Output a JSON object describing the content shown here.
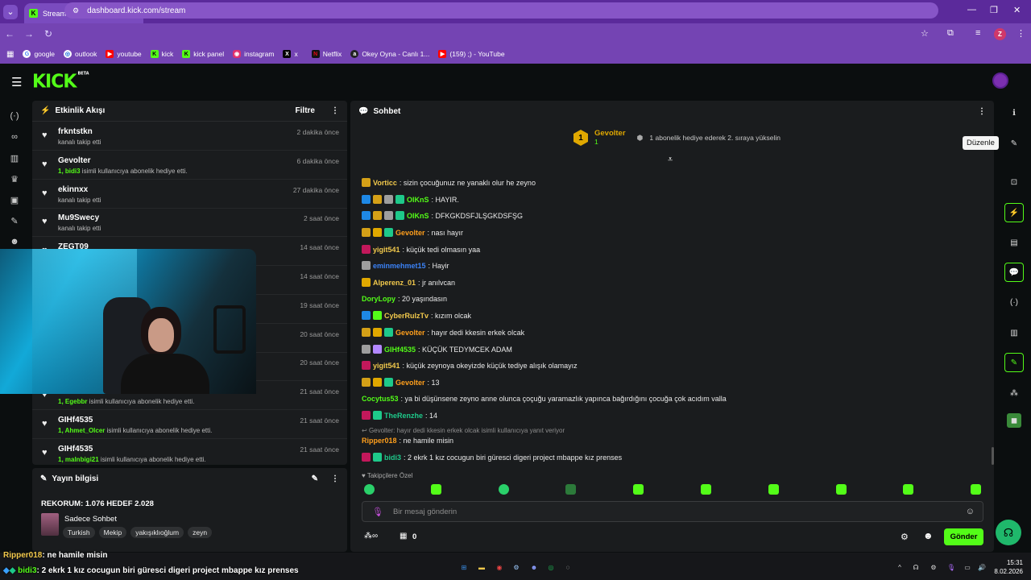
{
  "browser": {
    "tab_title": "Stream - Kick Dashboard",
    "url": "dashboard.kick.com/stream",
    "profile_initial": "Z",
    "bookmarks": [
      {
        "label": "google",
        "color": "#4285f4"
      },
      {
        "label": "outlook",
        "color": "#0a64d8"
      },
      {
        "label": "youtube",
        "color": "#ff0000"
      },
      {
        "label": "kick",
        "color": "#53fc18"
      },
      {
        "label": "kick panel",
        "color": "#53fc18"
      },
      {
        "label": "instagram",
        "color": "#e1306c"
      },
      {
        "label": "x",
        "color": "#000000"
      },
      {
        "label": "Netflix",
        "color": "#e50914"
      },
      {
        "label": "Okey Oyna - Canlı 1...",
        "color": "#222222"
      },
      {
        "label": "(159) ;) - YouTube",
        "color": "#ff0000"
      }
    ]
  },
  "kick": {
    "logo": "KICK",
    "logo_sup": "BETA"
  },
  "activity": {
    "title": "Etkinlik Akışı",
    "filter_label": "Filtre",
    "items": [
      {
        "name": "frkntstkn",
        "sub_count": "",
        "sub": "kanalı takip etti",
        "time": "2 dakika önce"
      },
      {
        "name": "Gevolter",
        "sub_count": "1, bidi3",
        "sub": "isimli kullanıcıya abonelik hediye etti.",
        "time": "6 dakika önce"
      },
      {
        "name": "ekinnxx",
        "sub_count": "",
        "sub": "kanalı takip etti",
        "time": "27 dakika önce"
      },
      {
        "name": "Mu9Swecy",
        "sub_count": "",
        "sub": "kanalı takip etti",
        "time": "2 saat önce"
      },
      {
        "name": "ZEGT09",
        "sub_count": "",
        "sub": "",
        "time": "14 saat önce"
      },
      {
        "name": "",
        "sub_count": "",
        "sub": "",
        "time": "14 saat önce"
      },
      {
        "name": "",
        "sub_count": "",
        "sub": "",
        "time": "19 saat önce"
      },
      {
        "name": "",
        "sub_count": "",
        "sub": "",
        "time": "20 saat önce"
      },
      {
        "name": "",
        "sub_count": "",
        "sub": "",
        "time": "20 saat önce"
      },
      {
        "name": "GIHf4535",
        "sub_count": "1, Egebbr",
        "sub": "isimli kullanıcıya abonelik hediye etti.",
        "time": "21 saat önce"
      },
      {
        "name": "GIHf4535",
        "sub_count": "1, Ahmet_Olcer",
        "sub": "isimli kullanıcıya abonelik hediye etti.",
        "time": "21 saat önce"
      },
      {
        "name": "GIHf4535",
        "sub_count": "1, malnbigi21",
        "sub": "isimli kullanıcıya abonelik hediye etti.",
        "time": "21 saat önce"
      }
    ]
  },
  "stream_info": {
    "title": "Yayın bilgisi",
    "stream_title": "REKORUM: 1.076 HEDEF 2.028",
    "category": "Sadece Sohbet",
    "tags": [
      "Turkish",
      "Mekip",
      "yakışıklıoğlum",
      "zeyn"
    ]
  },
  "chat": {
    "title": "Sohbet",
    "pinned_user": "Gevolter",
    "pinned_rank": "1",
    "pinned_count": "1",
    "pinned_text": "1 abonelik hediye ederek 2. sıraya yükselin",
    "messages": [
      {
        "user": "Vorticc",
        "color": "#f2c94c",
        "text": ": sizin çocuğunuz ne yanaklı olur he zeyno",
        "badges": [
          "#d4a017"
        ]
      },
      {
        "user": "OIKnS",
        "color": "#53fc18",
        "text": ": HAYIR.",
        "badges": [
          "#1e88e5",
          "#d4a017",
          "#9e9e9e",
          "#1ec98a"
        ]
      },
      {
        "user": "OIKnS",
        "color": "#53fc18",
        "text": ": DFKGKDSFJLŞGKDSFŞG",
        "badges": [
          "#1e88e5",
          "#d4a017",
          "#9e9e9e",
          "#1ec98a"
        ]
      },
      {
        "user": "Gevolter",
        "color": "#ff9f1c",
        "text": ": nası hayır",
        "badges": [
          "#d4a017",
          "#e0a800",
          "#1ec98a"
        ]
      },
      {
        "user": "yigit541",
        "color": "#f2c94c",
        "text": ": küçük tedi olmasın yaa",
        "badges": [
          "#c2185b"
        ]
      },
      {
        "user": "eminmehmet15",
        "color": "#3b82f6",
        "text": ": Hayir",
        "badges": [
          "#9e9e9e"
        ]
      },
      {
        "user": "Alperenz_01",
        "color": "#f2c94c",
        "text": ": jr anılvcan",
        "badges": [
          "#e0a800"
        ]
      },
      {
        "user": "DoryLopy",
        "color": "#53fc18",
        "text": ": 20 yaşındasın",
        "badges": []
      },
      {
        "user": "CyberRulzTv",
        "color": "#f2c94c",
        "text": ": kızım olcak",
        "badges": [
          "#1e88e5",
          "#53fc18"
        ]
      },
      {
        "user": "Gevolter",
        "color": "#ff9f1c",
        "text": ": hayır dedi kkesin erkek olcak",
        "badges": [
          "#d4a017",
          "#e0a800",
          "#1ec98a"
        ]
      },
      {
        "user": "GIHf4535",
        "color": "#53fc18",
        "text": ": KÜÇÜK TEDYMCEK ADAM",
        "badges": [
          "#9e9e9e",
          "#b388ff"
        ]
      },
      {
        "user": "yigit541",
        "color": "#f2c94c",
        "text": ": küçük zeynoya okeyizde küçük tediye alışık olamayız",
        "badges": [
          "#c2185b"
        ]
      },
      {
        "user": "Gevolter",
        "color": "#ff9f1c",
        "text": ": 13",
        "badges": [
          "#d4a017",
          "#e0a800",
          "#1ec98a"
        ]
      },
      {
        "user": "Cocytus53",
        "color": "#53fc18",
        "text": ": ya bi düşünsene zeyno anne olunca çoçuğu yaramazlık yapınca bağırdığını çocuğa çok acıdım valla",
        "badges": []
      },
      {
        "user": "TheRenzhe",
        "color": "#1ec98a",
        "text": ": 14",
        "badges": [
          "#c2185b",
          "#1ec98a"
        ]
      },
      {
        "user": "Ripper018",
        "color": "#ff9f1c",
        "text": ": ne hamile misin",
        "badges": []
      },
      {
        "user": "bidi3",
        "color": "#1ec98a",
        "text": ": 2 ekrk 1 kız cocugun biri güresci digeri project mbappe kız prenses",
        "badges": [
          "#c2185b",
          "#1ec98a"
        ]
      }
    ],
    "reply_context": "Gevolter: hayır dedi kkesin erkek olcak isimli kullanıcıya yanıt veriyor",
    "followers_label": "Takipçilere Özel",
    "input_placeholder": "Bir mesaj gönderin",
    "points": "0",
    "send_label": "Gönder"
  },
  "right_rail": {
    "tooltip": "Düzenle"
  },
  "overlay_chat": [
    {
      "user": "Ripper018",
      "text": ": ne hamile misin",
      "color": "#f2c94c"
    },
    {
      "user": "bidi3",
      "text": ": 2 ekrk 1 kız cocugun biri güresci digeri project mbappe kız prenses",
      "color": "#53fc18"
    }
  ],
  "taskbar": {
    "time": "15:31",
    "date": "8.02.2026"
  }
}
